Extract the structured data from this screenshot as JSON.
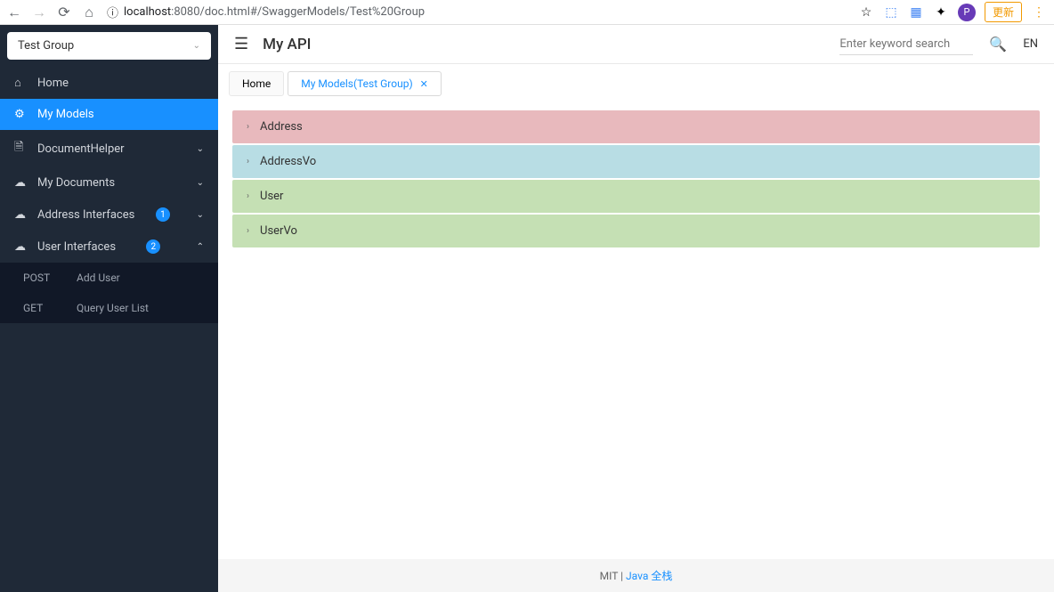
{
  "browser": {
    "url_prefix": "localhost",
    "url_port": ":8080",
    "url_path": "/doc.html#/SwaggerModels/Test%20Group",
    "update_label": "更新",
    "avatar_letter": "P"
  },
  "sidebar": {
    "group_selected": "Test Group",
    "items": [
      {
        "icon": "home",
        "label": "Home"
      },
      {
        "icon": "models",
        "label": "My Models"
      },
      {
        "icon": "doc",
        "label": "DocumentHelper"
      },
      {
        "icon": "cloud",
        "label": "My Documents"
      },
      {
        "icon": "cloud",
        "label": "Address Interfaces",
        "badge": "1"
      },
      {
        "icon": "cloud",
        "label": "User Interfaces",
        "badge": "2"
      }
    ],
    "sub_items": [
      {
        "method": "POST",
        "label": "Add User"
      },
      {
        "method": "GET",
        "label": "Query User List"
      }
    ]
  },
  "header": {
    "title": "My API",
    "search_placeholder": "Enter keyword search",
    "lang": "EN"
  },
  "tabs": [
    {
      "label": "Home"
    },
    {
      "label": "My Models(Test Group)"
    }
  ],
  "models": [
    {
      "name": "Address",
      "color": "pink"
    },
    {
      "name": "AddressVo",
      "color": "blue"
    },
    {
      "name": "User",
      "color": "green"
    },
    {
      "name": "UserVo",
      "color": "green"
    }
  ],
  "footer": {
    "license": "MIT",
    "separator": " | ",
    "link_text": "Java 全栈"
  }
}
